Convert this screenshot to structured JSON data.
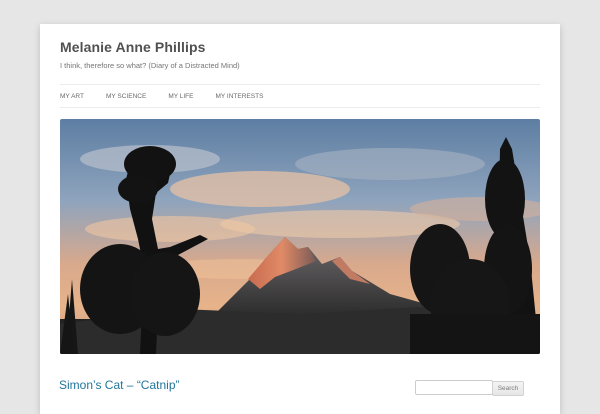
{
  "site": {
    "title": "Melanie Anne Phillips",
    "description": "I think, therefore so what? (Diary of a Distracted Mind)"
  },
  "nav": {
    "items": [
      {
        "label": "MY ART"
      },
      {
        "label": "MY SCIENCE"
      },
      {
        "label": "MY LIFE"
      },
      {
        "label": "MY INTERESTS"
      }
    ]
  },
  "header_image": {
    "subject": "mountain-peak-sunset-with-tree-silhouettes"
  },
  "post": {
    "title": "Simon’s Cat – “Catnip”"
  },
  "search": {
    "placeholder": "",
    "value": "",
    "button_label": "Search"
  },
  "colors": {
    "background": "#e6e6e6",
    "page": "#ffffff",
    "link": "#21759b",
    "title": "#515151"
  }
}
